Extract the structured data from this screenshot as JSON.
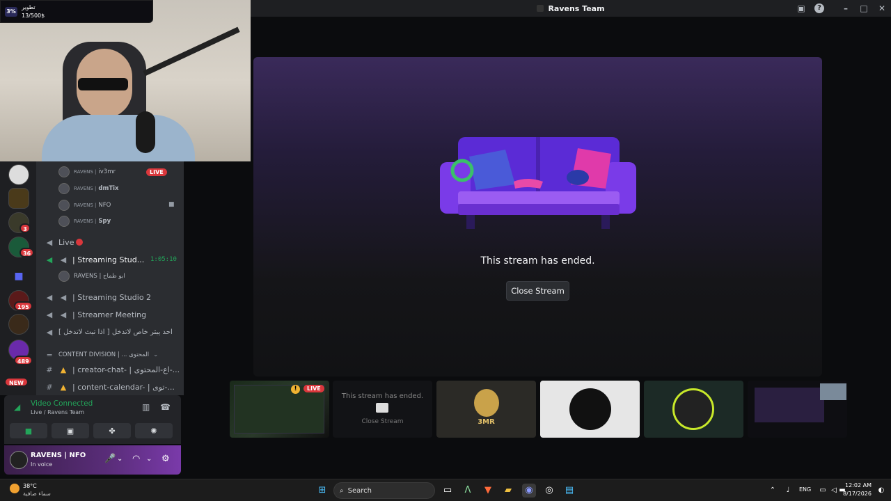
{
  "window": {
    "title": "Ravens Team"
  },
  "stream": {
    "ended_text": "This stream has ended.",
    "close_label": "Close Stream"
  },
  "goal": {
    "percent": "3%",
    "title": "تطوير",
    "amount": "13/500$"
  },
  "guild_badges": [
    "3",
    "36",
    "195",
    "489"
  ],
  "new_badge": "NEW",
  "members": [
    {
      "tag": "RAVENS |",
      "name": "iv3mr",
      "live": "LIVE"
    },
    {
      "tag": "RAVENS |",
      "name": "dmTix"
    },
    {
      "tag": "RAVENS |",
      "name": "NFO"
    },
    {
      "tag": "RAVENS |",
      "name": "Spy"
    }
  ],
  "channels": {
    "live": "Live",
    "streaming_studio": "| Streaming Stud...",
    "streaming_timer": "1:05:10",
    "studio_member": "RAVENS | ابو طماح",
    "streaming_studio_2": "| Streaming Studio 2",
    "streamer_meeting": "| Streamer Meeting",
    "private": "[ احد يبثر خاص لاتدخل [ اذا تبث لاتدخل",
    "category": "CONTENT DIVISION | ... المحتوى",
    "creator_chat": "| creator-chat- | اع-المحتوى-...",
    "content_calendar": "| content-calendar- | توى-..."
  },
  "voice": {
    "title": "Video Connected",
    "subtitle": "Live / Ravens Team"
  },
  "user": {
    "name": "RAVENS | NFO",
    "status": "In voice"
  },
  "thumbs": {
    "t1_live": "LIVE",
    "t2_text": "This stream has ended.",
    "t2_btn": "Close Stream",
    "t3_label": "3MR"
  },
  "taskbar": {
    "temp": "38°C",
    "weather": "سماء صافية",
    "search": "Search",
    "lang": "ENG",
    "time": "12:02 AM",
    "date": "8/17/2026"
  }
}
